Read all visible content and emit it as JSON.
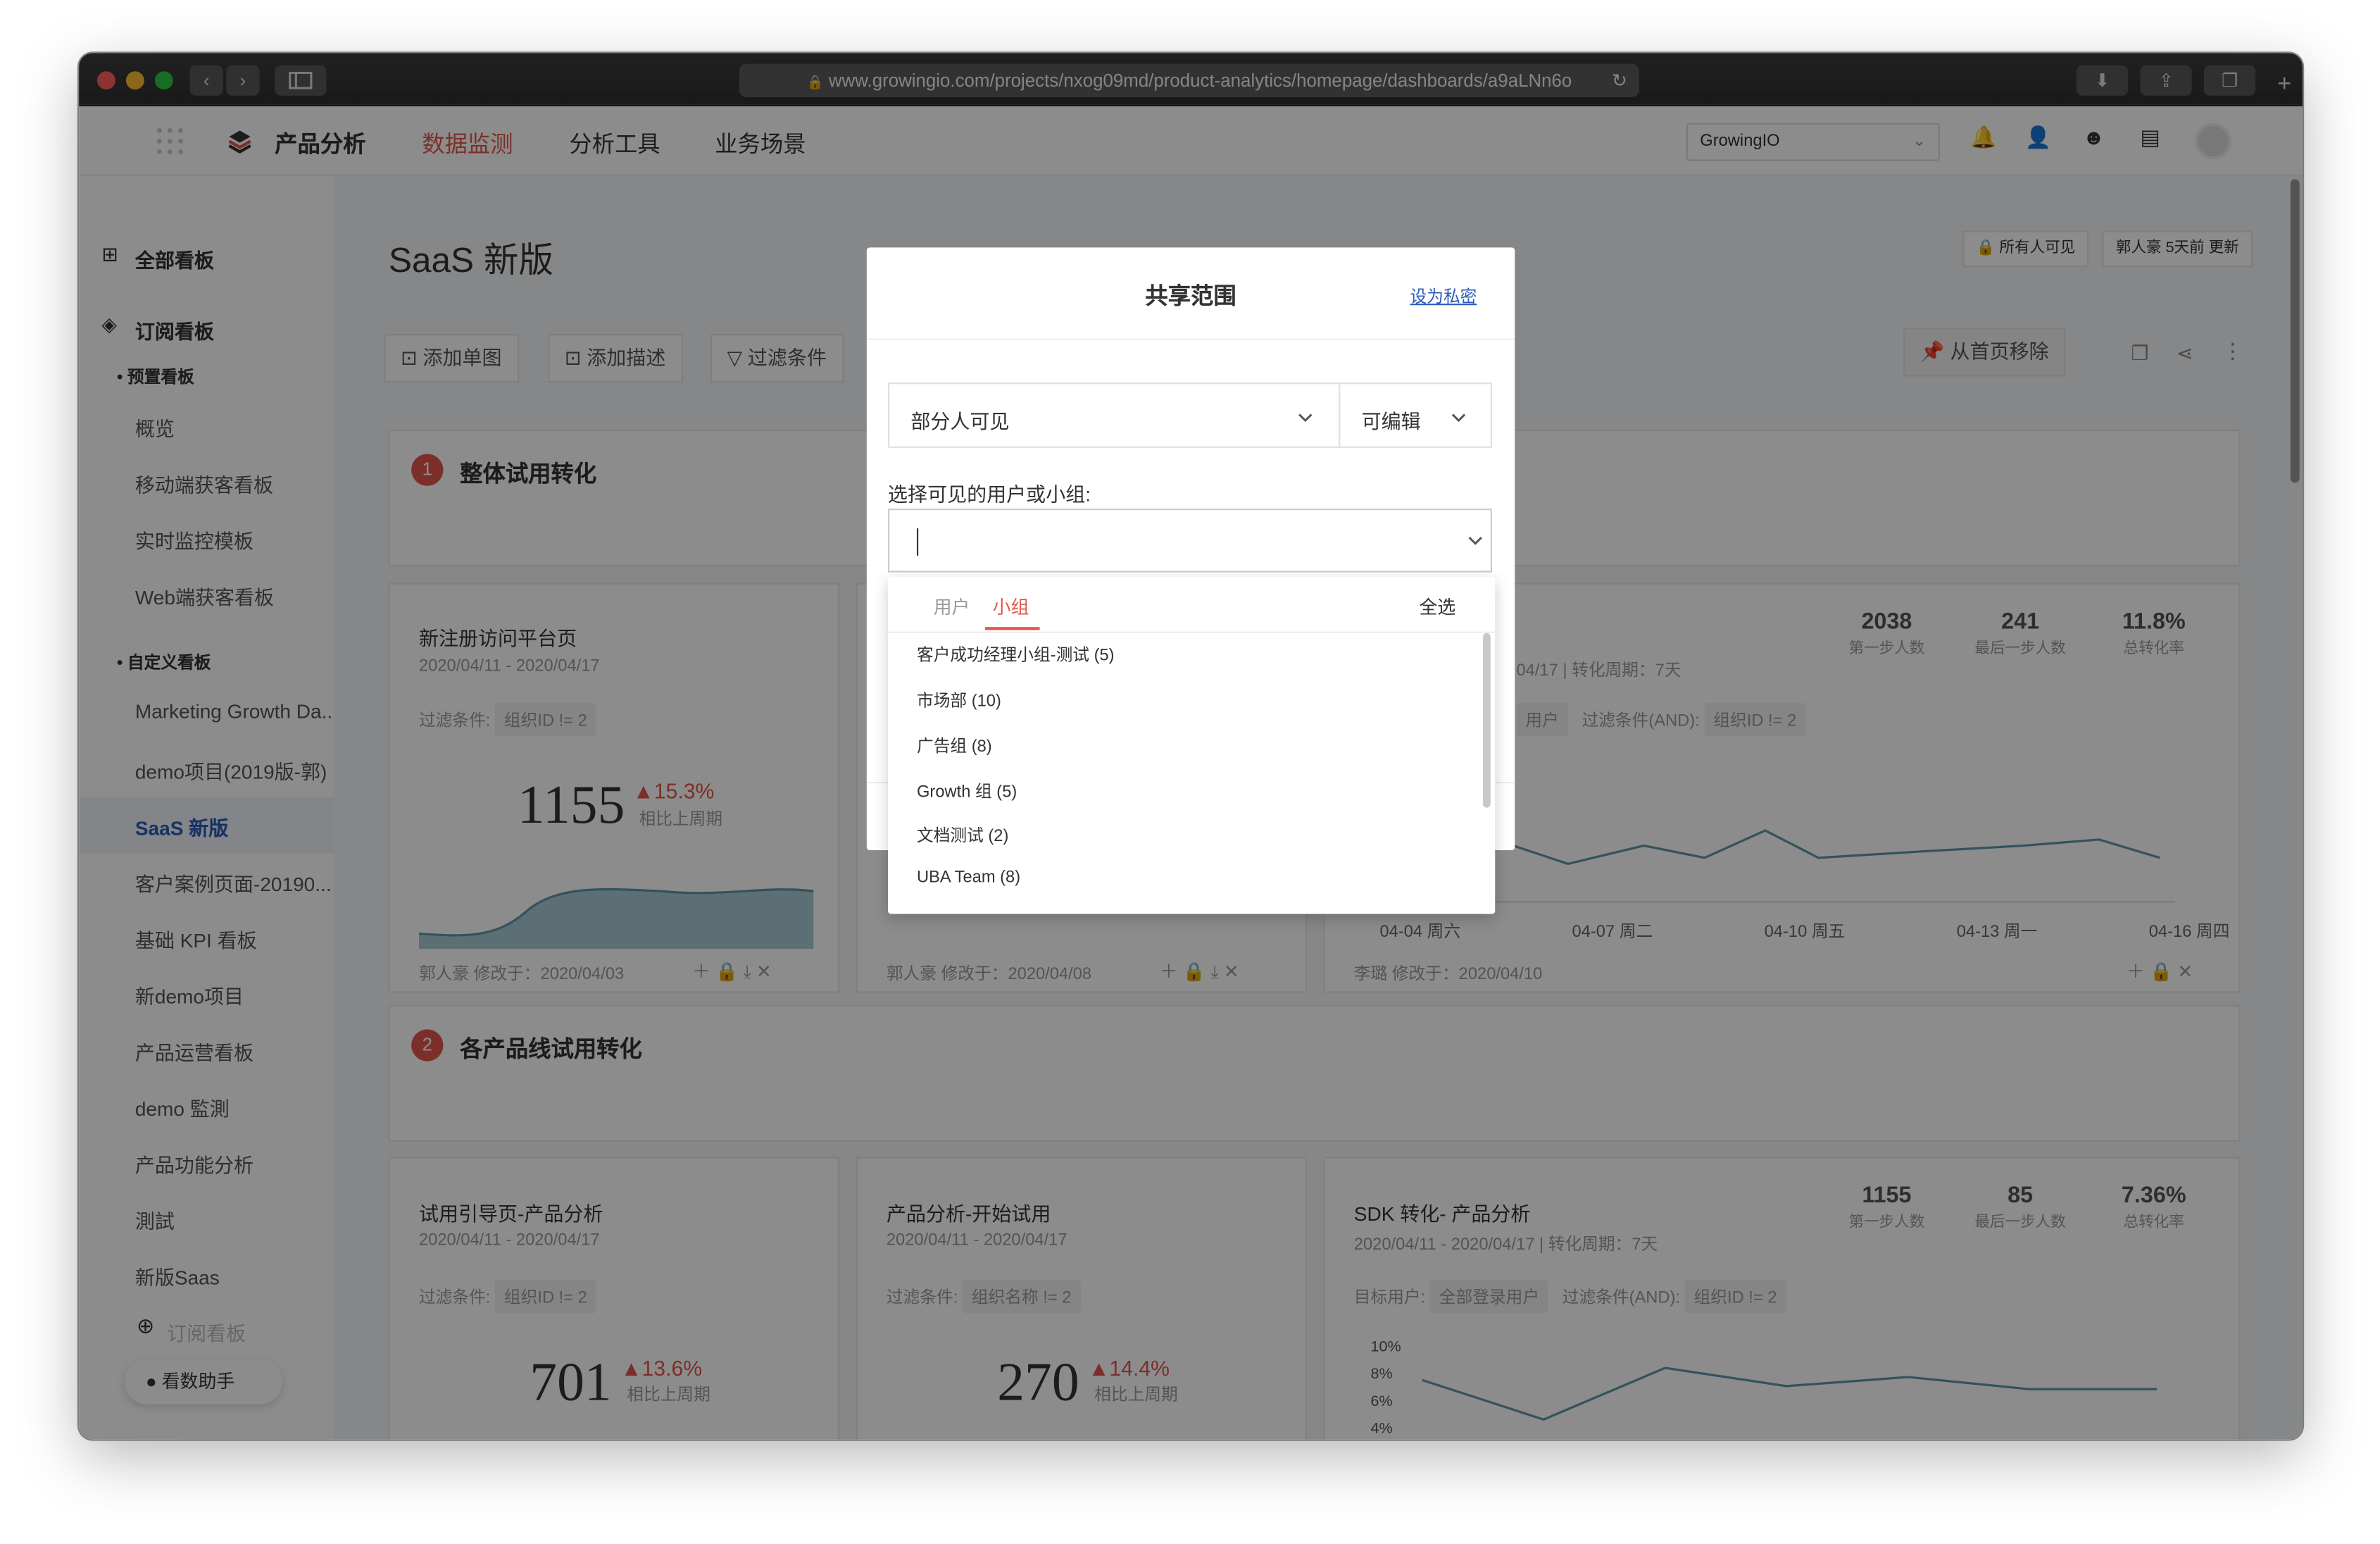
{
  "browser": {
    "url": "www.growingio.com/projects/nxog09md/product-analytics/homepage/dashboards/a9aLNn6o"
  },
  "appnav": {
    "brand": "产品分析",
    "items": [
      "数据监测",
      "分析工具",
      "业务场景"
    ],
    "project_select": "GrowingIO"
  },
  "sidebar": {
    "all_boards": "全部看板",
    "subscribed": "订阅看板",
    "preset_header": "预置看板",
    "preset_items": [
      "概览",
      "移动端获客看板",
      "实时监控模板",
      "Web端获客看板"
    ],
    "custom_header": "自定义看板",
    "custom_items": [
      "Marketing Growth Da...",
      "demo项目(2019版-郭)",
      "SaaS 新版",
      "客户案例页面-20190...",
      "基础 KPI 看板",
      "新demo项目",
      "产品运营看板",
      "demo 監測",
      "产品功能分析",
      "測試",
      "新版Saas"
    ],
    "subscribe_btn": "订阅看板",
    "assistant": "看数助手"
  },
  "page": {
    "title": "SaaS 新版",
    "visibility": "所有人可见",
    "updated": "郭人豪 5天前 更新",
    "toolbar": [
      "添加单图",
      "添加描述",
      "过滤条件"
    ],
    "remove_home": "从首页移除"
  },
  "sections": [
    {
      "num": "1",
      "title": "整体试用转化"
    },
    {
      "num": "2",
      "title": "各产品线试用转化"
    }
  ],
  "cards_row1": {
    "card1": {
      "title": "新注册访问平台页",
      "date": "2020/04/11 - 2020/04/17",
      "filter_label": "过滤条件:",
      "filter": "组织ID != 2",
      "value": "1155",
      "delta": "▲15.3%",
      "delta_label": "相比上周期",
      "footer": "郭人豪 修改于：2020/04/03"
    },
    "card2": {
      "footer": "郭人豪 修改于：2020/04/08"
    },
    "card3": {
      "subtitle": "04/17 | 转化周期：7天",
      "target_label": "用户",
      "filter_label": "过滤条件(AND):",
      "filter": "组织ID != 2",
      "stats": [
        {
          "value": "2038",
          "label": "第一步人数"
        },
        {
          "value": "241",
          "label": "最后一步人数"
        },
        {
          "value": "11.8%",
          "label": "总转化率"
        }
      ],
      "x_ticks": [
        "04-04 周六",
        "04-07 周二",
        "04-10 周五",
        "04-13 周一",
        "04-16 周四"
      ],
      "footer": "李璐 修改于：2020/04/10"
    }
  },
  "cards_row2": {
    "card1": {
      "title": "试用引导页-产品分析",
      "date": "2020/04/11 - 2020/04/17",
      "filter_label": "过滤条件:",
      "filter": "组织ID != 2",
      "value": "701",
      "delta": "▲13.6%",
      "delta_label": "相比上周期"
    },
    "card2": {
      "title": "产品分析-开始试用",
      "date": "2020/04/11 - 2020/04/17",
      "filter_label": "过滤条件:",
      "filter": "组织名称 != 2",
      "value": "270",
      "delta": "▲14.4%",
      "delta_label": "相比上周期"
    },
    "card3": {
      "title": "SDK 转化- 产品分析",
      "date": "2020/04/11 - 2020/04/17 | 转化周期：7天",
      "target_label": "目标用户:",
      "target": "全部登录用户",
      "filter_label": "过滤条件(AND):",
      "filter": "组织ID != 2",
      "stats": [
        {
          "value": "1155",
          "label": "第一步人数"
        },
        {
          "value": "85",
          "label": "最后一步人数"
        },
        {
          "value": "7.36%",
          "label": "总转化率"
        }
      ],
      "y_ticks": [
        "10%",
        "8%",
        "6%",
        "4%"
      ]
    }
  },
  "modal": {
    "title": "共享范围",
    "set_private": "设为私密",
    "visibility_select": "部分人可见",
    "permission_select": "可编辑",
    "select_label": "选择可见的用户或小组:",
    "tabs": [
      "用户",
      "小组"
    ],
    "select_all": "全选",
    "groups": [
      "客户成功经理小组-测试 (5)",
      "市场部 (10)",
      "广告组 (8)",
      "Growth 组 (5)",
      "文档测试 (2)",
      "UBA Team (8)"
    ]
  },
  "colors": {
    "accent": "#e2574c",
    "link": "#2b5cb8",
    "tab_active": "#e2574c",
    "line": "#5d97a8"
  }
}
